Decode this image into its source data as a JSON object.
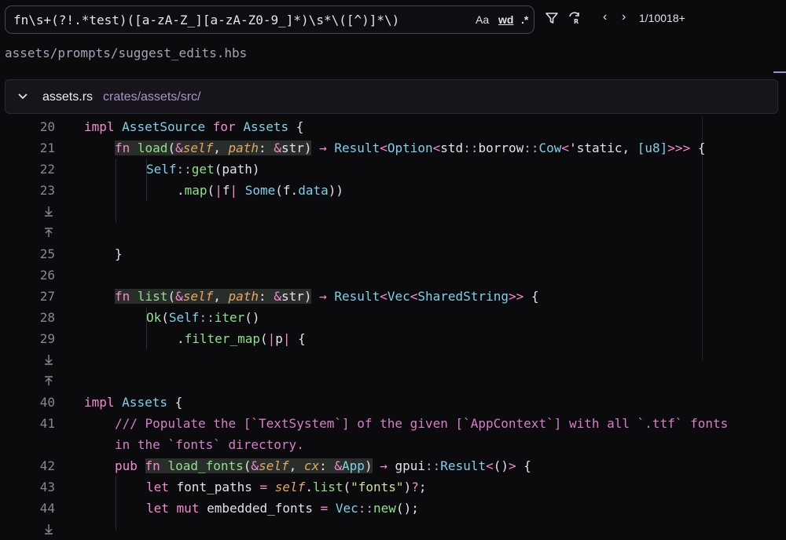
{
  "search": {
    "query": "fn\\s+(?!.*test)([a-zA-Z_][a-zA-Z0-9_]*)\\s*\\([^)]*\\)",
    "case_label": "Aa",
    "word_label": "wd",
    "regex_label": ".*",
    "prev_icon": "‹",
    "next_icon": "›",
    "match_count": "1/10018+"
  },
  "previous_file": "assets/prompts/suggest_edits.hbs",
  "file": {
    "name": "assets.rs",
    "dir": "crates/assets/src/"
  },
  "lines": [
    {
      "n": "20",
      "code": "impl AssetSource for Assets {"
    },
    {
      "n": "21",
      "code": "fn load(&self, path: &str) → Result<Option<std::borrow::Cow<'static, [u8]>>> {"
    },
    {
      "n": "22",
      "code": "Self::get(path)"
    },
    {
      "n": "23",
      "code": ".map(|f| Some(f.data))"
    },
    {
      "n": "",
      "code": ""
    },
    {
      "n": "",
      "code": ""
    },
    {
      "n": "25",
      "code": "}"
    },
    {
      "n": "26",
      "code": ""
    },
    {
      "n": "27",
      "code": "fn list(&self, path: &str) → Result<Vec<SharedString>> {"
    },
    {
      "n": "28",
      "code": "Ok(Self::iter()"
    },
    {
      "n": "29",
      "code": ".filter_map(|p| {"
    },
    {
      "n": "",
      "code": ""
    },
    {
      "n": "",
      "code": ""
    },
    {
      "n": "40",
      "code": "impl Assets {"
    },
    {
      "n": "41",
      "code": "/// Populate the [`TextSystem`] of the given [`AppContext`] with all `.ttf` fonts"
    },
    {
      "n": "",
      "code": "in the `fonts` directory."
    },
    {
      "n": "42",
      "code": "pub fn load_fonts(&self, cx: &App) → gpui::Result<()> {"
    },
    {
      "n": "43",
      "code": "let font_paths = self.list(\"fonts\")?;"
    },
    {
      "n": "44",
      "code": "let mut embedded_fonts = Vec::new();"
    }
  ]
}
